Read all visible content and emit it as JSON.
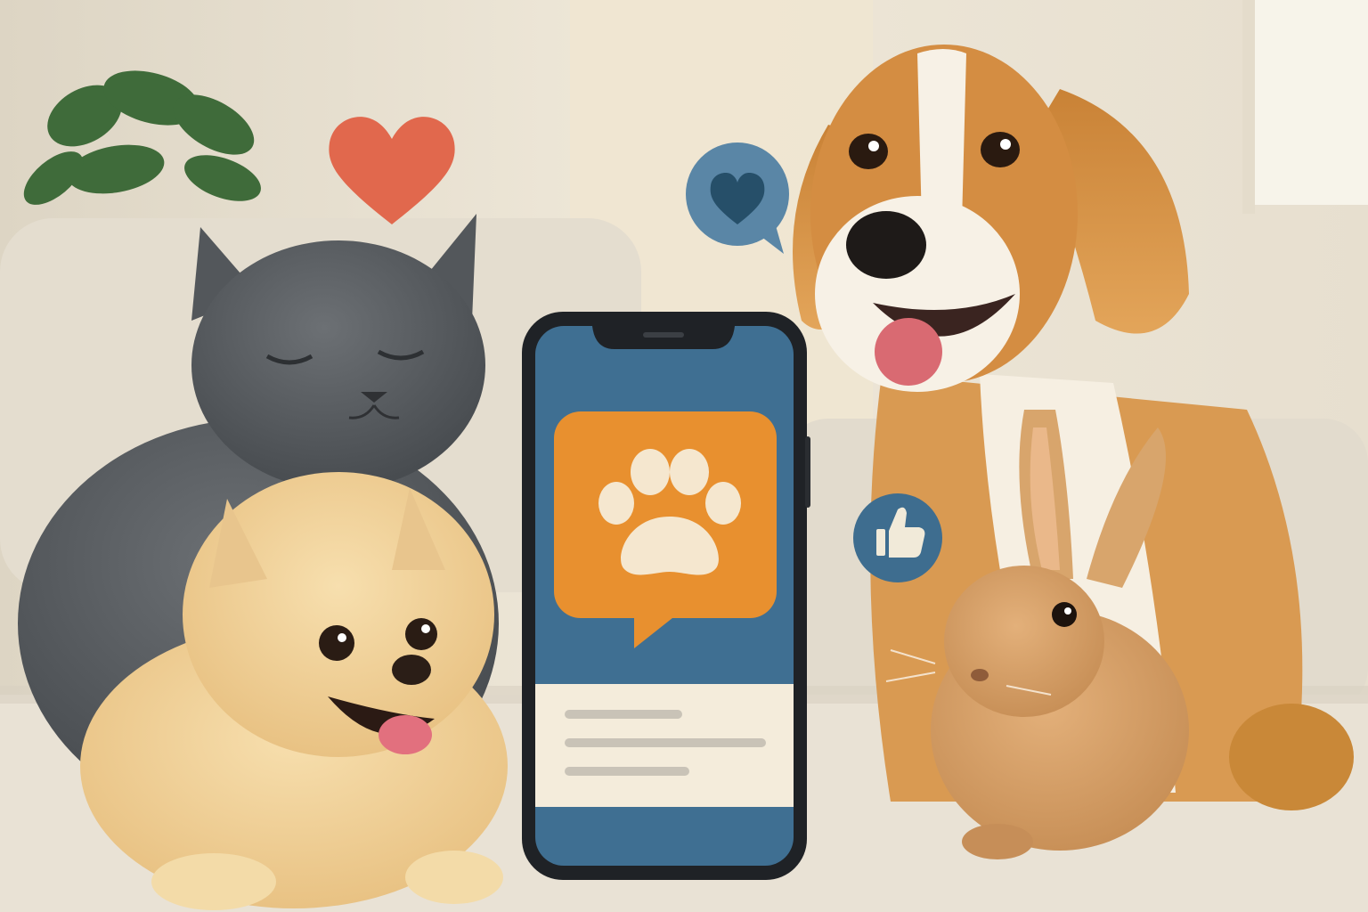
{
  "scene": {
    "description_free": true,
    "palette": {
      "wall": "#efe8da",
      "window_light": "#f6f2e6",
      "sofa": "#e6dfd2",
      "sofa_shadow": "#cfc6b6",
      "plant": "#3f6b3a",
      "cat": "#5b5f63",
      "pomeranian": "#f0cf96",
      "beagle_tan": "#d7954a",
      "beagle_white": "#f7f1e6",
      "rabbit": "#d6a067",
      "phone_body": "#1f2226",
      "screen_blue": "#3f6f92",
      "bubble_orange": "#e8902f",
      "paw": "#f5e7cf",
      "card": "#f4ecdb",
      "card_line": "#c9c3b7",
      "heart_red": "#e1684d",
      "chat_blue": "#5a86a6",
      "chat_heart": "#264f69",
      "like_blue": "#3e6d8f",
      "like_thumb": "#f1ead9"
    },
    "icons": {
      "floating_heart": "heart-icon",
      "chat_bubble": "chat-heart-icon",
      "like_badge": "thumbs-up-icon",
      "app_logo": "paw-icon"
    }
  }
}
